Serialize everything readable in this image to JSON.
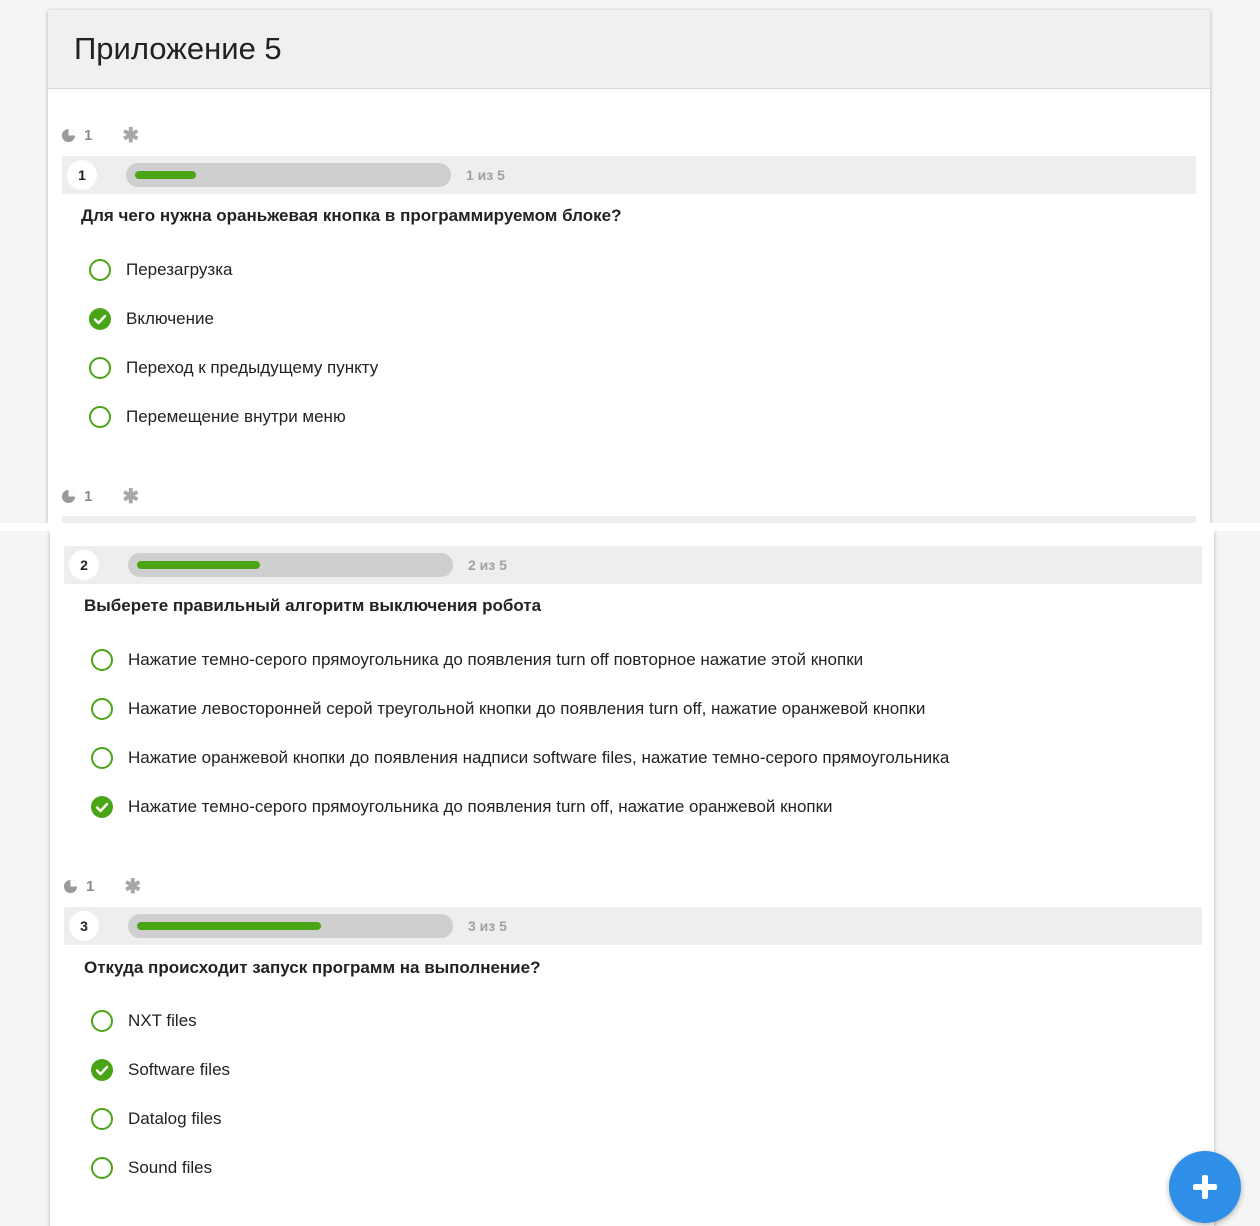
{
  "page_title": "Приложение 5",
  "colors": {
    "accent_green": "#4aa516",
    "fab_blue": "#2f8fe8",
    "header_bg": "#f0f0f0"
  },
  "questions": [
    {
      "number": "1",
      "points": "1",
      "progress_text": "1 из 5",
      "progress": 0.2,
      "text": "Для чего нужна ораньжевая кнопка в программируемом блоке?",
      "answers": [
        {
          "label": "Перезагрузка",
          "correct": false
        },
        {
          "label": "Включение",
          "correct": true
        },
        {
          "label": "Переход к предыдущему пункту",
          "correct": false
        },
        {
          "label": "Перемещение внутри меню",
          "correct": false
        }
      ]
    },
    {
      "number": "2",
      "points": "1",
      "progress_text": "2 из 5",
      "progress": 0.4,
      "text": "Выберете правильный алгоритм выключения робота",
      "answers": [
        {
          "label": "Нажатие темно-серого прямоугольника до появления turn off повторное нажатие этой кнопки",
          "correct": false
        },
        {
          "label": "Нажатие левосторонней серой треугольной кнопки до появления turn off, нажатие оранжевой кнопки",
          "correct": false
        },
        {
          "label": "Нажатие оранжевой кнопки до появления надписи software files, нажатие темно-серого прямоугольника",
          "correct": false
        },
        {
          "label": "Нажатие темно-серого прямоугольника до появления turn off, нажатие оранжевой кнопки",
          "correct": true
        }
      ]
    },
    {
      "number": "3",
      "points": "1",
      "progress_text": "3 из 5",
      "progress": 0.6,
      "text": "Откуда происходит запуск программ на выполнение?",
      "answers": [
        {
          "label": "NXT files",
          "correct": false
        },
        {
          "label": "Software files",
          "correct": true
        },
        {
          "label": "Datalog files",
          "correct": false
        },
        {
          "label": "Sound files",
          "correct": false
        }
      ]
    }
  ],
  "second_points_top": "1",
  "icons": {
    "points": "pie-chart-icon",
    "required": "asterisk-icon",
    "answer_unselected": "radio-empty-icon",
    "answer_correct": "check-circle-icon",
    "fab": "plus-icon"
  }
}
